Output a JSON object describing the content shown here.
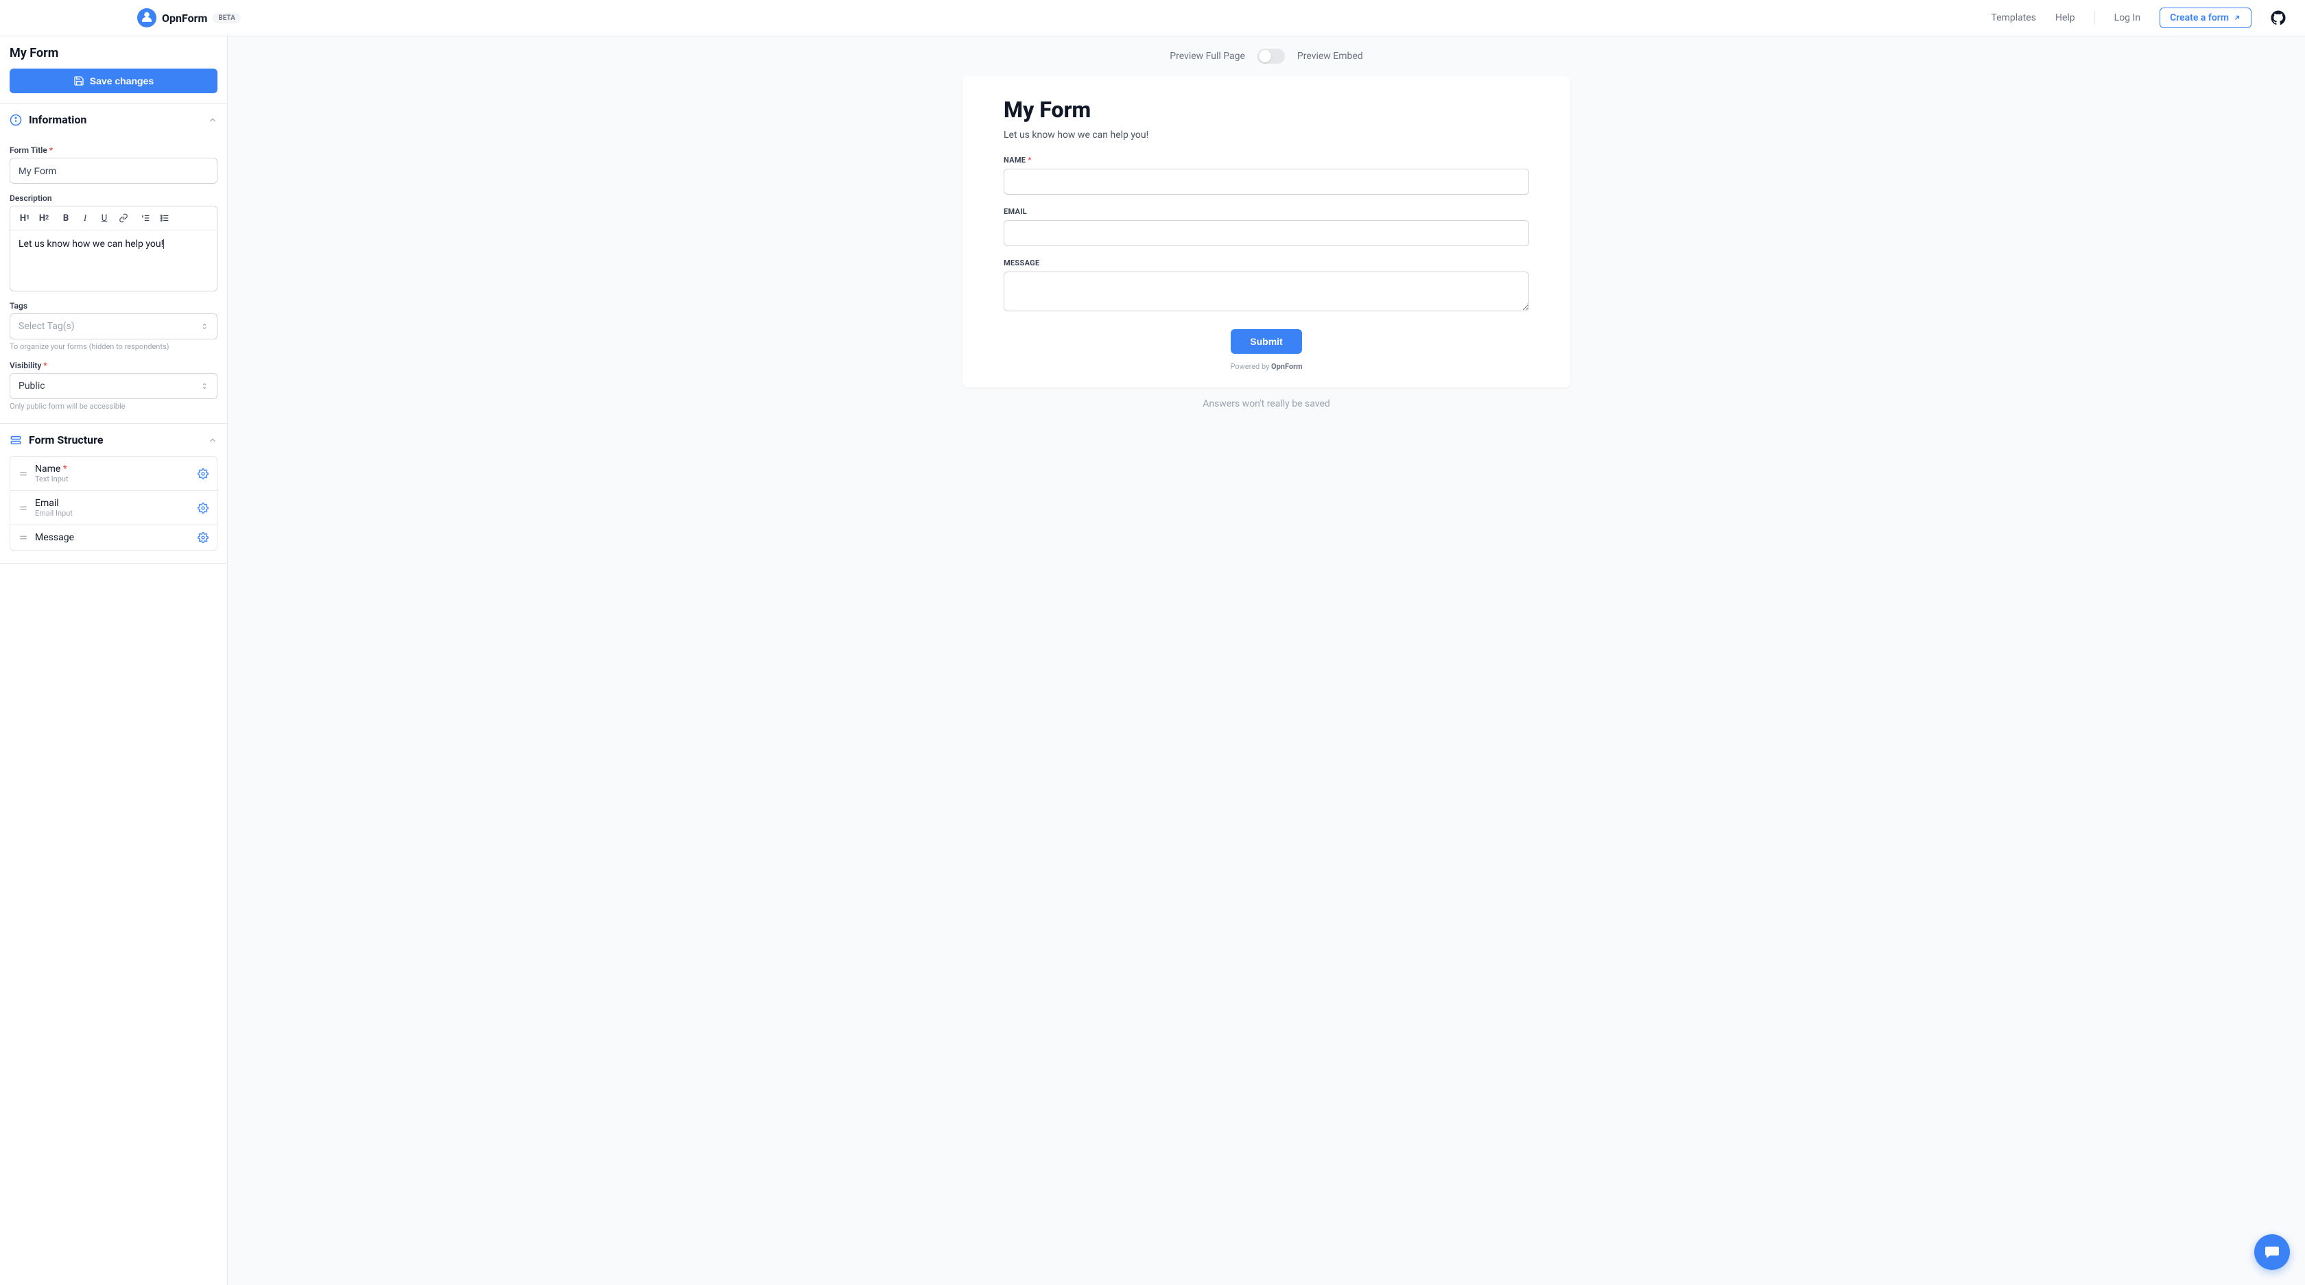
{
  "brand": {
    "name": "OpnForm",
    "badge": "BETA"
  },
  "nav": {
    "templates": "Templates",
    "help": "Help",
    "login": "Log In",
    "create": "Create a form"
  },
  "sidebar": {
    "form_name": "My Form",
    "save_btn": "Save changes",
    "information": {
      "heading": "Information",
      "form_title_label": "Form Title",
      "form_title_value": "My Form",
      "description_label": "Description",
      "description_value": "Let us know how we can help you!",
      "tags_label": "Tags",
      "tags_placeholder": "Select Tag(s)",
      "tags_help": "To organize your forms (hidden to respondents)",
      "visibility_label": "Visibility",
      "visibility_value": "Public",
      "visibility_help": "Only public form will be accessible"
    },
    "structure": {
      "heading": "Form Structure",
      "items": [
        {
          "name": "Name",
          "required": true,
          "type": "Text Input"
        },
        {
          "name": "Email",
          "required": false,
          "type": "Email Input"
        },
        {
          "name": "Message",
          "required": false,
          "type": ""
        }
      ]
    }
  },
  "preview": {
    "full_page": "Preview Full Page",
    "embed": "Preview Embed",
    "form_title": "My Form",
    "form_desc": "Let us know how we can help you!",
    "fields": [
      {
        "label": "NAME",
        "required": true,
        "kind": "text"
      },
      {
        "label": "EMAIL",
        "required": false,
        "kind": "text"
      },
      {
        "label": "MESSAGE",
        "required": false,
        "kind": "textarea"
      }
    ],
    "submit": "Submit",
    "powered_prefix": "Powered by ",
    "powered_name": "OpnForm",
    "not_saved": "Answers won't really be saved"
  }
}
